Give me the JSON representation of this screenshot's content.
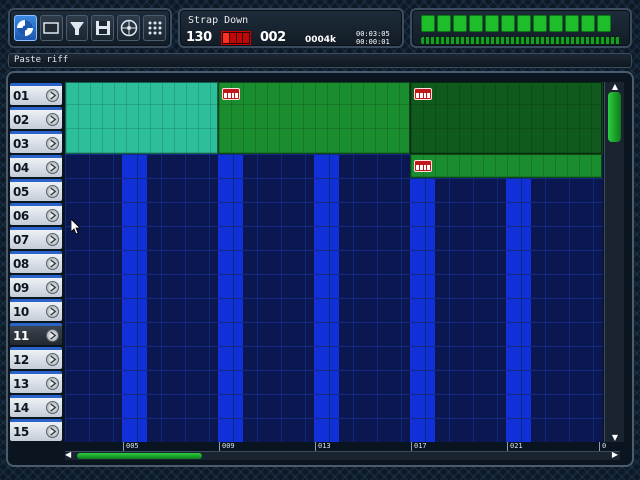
{
  "toolbar": {
    "buttons": [
      {
        "icon": "disc-icon",
        "active": true
      },
      {
        "icon": "screen-icon",
        "active": false
      },
      {
        "icon": "funnel-icon",
        "active": false
      },
      {
        "icon": "save-icon",
        "active": false
      },
      {
        "icon": "reel-icon",
        "active": false
      },
      {
        "icon": "dots-grid-icon",
        "active": false
      }
    ]
  },
  "song": {
    "title": "Strap Down",
    "tempo": "130",
    "pattern": "002",
    "memory": "0004k",
    "time_a": "00:03:05",
    "time_b": "00:00:01"
  },
  "status": {
    "text": "Paste riff"
  },
  "tracks": [
    "01",
    "02",
    "03",
    "04",
    "05",
    "06",
    "07",
    "08",
    "09",
    "10",
    "11",
    "12",
    "13",
    "14",
    "15"
  ],
  "selected_track": "11",
  "ruler": [
    "005",
    "009",
    "013",
    "017",
    "021",
    "0"
  ],
  "colors": {
    "grid_bg": "#0a1750",
    "pattern_column": "#1130d8",
    "block_teal": "#2dbf9a",
    "block_green": "#1a8e2e",
    "block_darkgreen": "#0f5a1c",
    "accent_blue": "#2a64c8"
  }
}
